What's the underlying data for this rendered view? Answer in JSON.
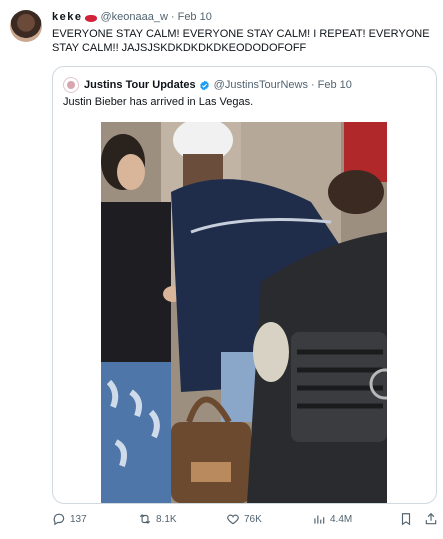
{
  "tweet": {
    "display_name": "keke",
    "handle": "@keonaaa_w",
    "separator": "·",
    "date": "Feb 10",
    "text": "EVERYONE STAY CALM! EVERYONE STAY CALM! I REPEAT! EVERYONE STAY CALM!! JAJSJSKDKDKDKDKEODODOFOFF"
  },
  "quote": {
    "display_name": "Justins Tour Updates",
    "handle": "@JustinsTourNews",
    "separator": "·",
    "date": "Feb 10",
    "text": "Justin Bieber has arrived in Las Vegas."
  },
  "actions": {
    "replies": "137",
    "reposts": "8.1K",
    "likes": "76K",
    "views": "4.4M"
  },
  "colors": {
    "muted": "#536471",
    "verified": "#1d9bf0",
    "border": "#cfd9de"
  }
}
